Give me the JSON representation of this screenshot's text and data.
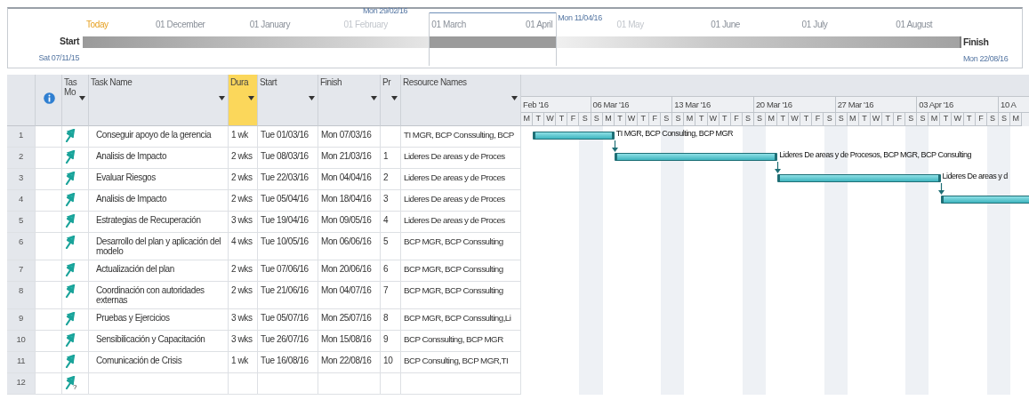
{
  "timeline": {
    "start_label": "Start",
    "start_date": "Sat 07/11/15",
    "finish_label": "Finish",
    "finish_date": "Mon 22/08/16",
    "today": "Today",
    "range_start": "Mon 29/02/16",
    "range_end": "Mon 11/04/16",
    "months": [
      "01 December",
      "01 January",
      "01 February",
      "01 March",
      "01 April",
      "01 May",
      "01 June",
      "01 July",
      "01 August"
    ]
  },
  "table": {
    "columns": [
      {
        "kind": "num",
        "selected": false
      },
      {
        "kind": "info",
        "selected": false
      },
      {
        "kind": "mode",
        "label": "Tas Mo",
        "selected": false,
        "filter": true
      },
      {
        "kind": "name",
        "label": "Task Name",
        "selected": false,
        "filter": true
      },
      {
        "kind": "dur",
        "label": "Dura",
        "selected": true,
        "filter": true
      },
      {
        "kind": "start",
        "label": "Start",
        "selected": false,
        "filter": true
      },
      {
        "kind": "finish",
        "label": "Finish",
        "selected": false,
        "filter": true
      },
      {
        "kind": "pred",
        "label": "Pr",
        "selected": false,
        "filter": true
      },
      {
        "kind": "res",
        "label": "Resource Names",
        "selected": false,
        "filter": true
      }
    ],
    "rows": [
      {
        "id": "1",
        "kind": "auto",
        "name": "Conseguir apoyo de la gerencia",
        "duration": "1 wk",
        "start": "Tue 01/03/16",
        "finish": "Mon 07/03/16",
        "resources": "TI MGR, BCP Conssulting, BCP",
        "bar_label": "TI MGR, BCP Consulting, BCP MGR"
      },
      {
        "id": "2",
        "kind": "auto",
        "name": "Analisis de Impacto",
        "duration": "2 wks",
        "start": "Tue 08/03/16",
        "finish": "Mon 21/03/16",
        "pred": "1",
        "resources": "Lideres De areas y de Proces",
        "bar_label": "Lideres De areas y de Procesos, BCP MGR, BCP Consulting"
      },
      {
        "id": "3",
        "kind": "auto",
        "name": "Evaluar Riesgos",
        "duration": "2 wks",
        "start": "Tue 22/03/16",
        "finish": "Mon 04/04/16",
        "pred": "2",
        "resources": "Lideres De areas y de Proces",
        "bar_label": "Lideres De areas y d"
      },
      {
        "id": "4",
        "kind": "auto",
        "name": "Analisis de Impacto",
        "duration": "2 wks",
        "start": "Tue 05/04/16",
        "finish": "Mon 18/04/16",
        "pred": "3",
        "resources": "Lideres De areas y de Proces"
      },
      {
        "id": "5",
        "kind": "auto",
        "name": "Estrategias de Recuperación",
        "duration": "3 wks",
        "start": "Tue 19/04/16",
        "finish": "Mon 09/05/16",
        "pred": "4",
        "resources": "Lideres De areas y de Proces"
      },
      {
        "id": "6",
        "kind": "auto",
        "name": "Desarrollo del plan y aplicación del modelo",
        "duration": "4 wks",
        "start": "Tue 10/05/16",
        "finish": "Mon 06/06/16",
        "pred": "5",
        "resources": "BCP MGR, BCP Conssulting"
      },
      {
        "id": "7",
        "kind": "auto",
        "name": "Actualización del plan",
        "duration": "2 wks",
        "start": "Tue 07/06/16",
        "finish": "Mon 20/06/16",
        "pred": "6",
        "resources": "BCP MGR, BCP Conssulting"
      },
      {
        "id": "8",
        "kind": "auto",
        "name": "Coordinación con autoridades externas",
        "duration": "2 wks",
        "start": "Tue 21/06/16",
        "finish": "Mon 04/07/16",
        "pred": "7",
        "resources": "BCP MGR, BCP Conssulting"
      },
      {
        "id": "9",
        "kind": "auto",
        "name": "Pruebas y Ejercicios",
        "duration": "3 wks",
        "start": "Tue 05/07/16",
        "finish": "Mon 25/07/16",
        "pred": "8",
        "resources": "BCP MGR, BCP Conssulting,Li"
      },
      {
        "id": "10",
        "kind": "auto",
        "name": "Sensibilicación y Capacitación",
        "duration": "3 wks",
        "start": "Tue 26/07/16",
        "finish": "Mon 15/08/16",
        "pred": "9",
        "resources": "BCP Conssulting, BCP MGR"
      },
      {
        "id": "11",
        "kind": "auto",
        "name": "Comunicación de Crisis",
        "duration": "1 wk",
        "start": "Tue 16/08/16",
        "finish": "Mon 22/08/16",
        "pred": "10",
        "resources": "BCP Consulting, BCP MGR,TI"
      },
      {
        "id": "12",
        "kind": "new",
        "mode_mark": "?"
      }
    ]
  },
  "gantt": {
    "weeks": [
      "Feb '16",
      "06 Mar '16",
      "13 Mar '16",
      "20 Mar '16",
      "27 Mar '16",
      "03 Apr '16",
      "10 A"
    ],
    "days": [
      "M",
      "T",
      "W",
      "T",
      "F",
      "S",
      "S",
      "M",
      "T",
      "W",
      "T",
      "F",
      "S",
      "S",
      "M",
      "T",
      "W",
      "T",
      "F",
      "S",
      "S",
      "M",
      "T",
      "W",
      "T",
      "F",
      "S",
      "S",
      "M",
      "T",
      "W",
      "T",
      "F",
      "S",
      "S",
      "M",
      "T",
      "W",
      "T",
      "F",
      "S",
      "S",
      "M"
    ]
  }
}
